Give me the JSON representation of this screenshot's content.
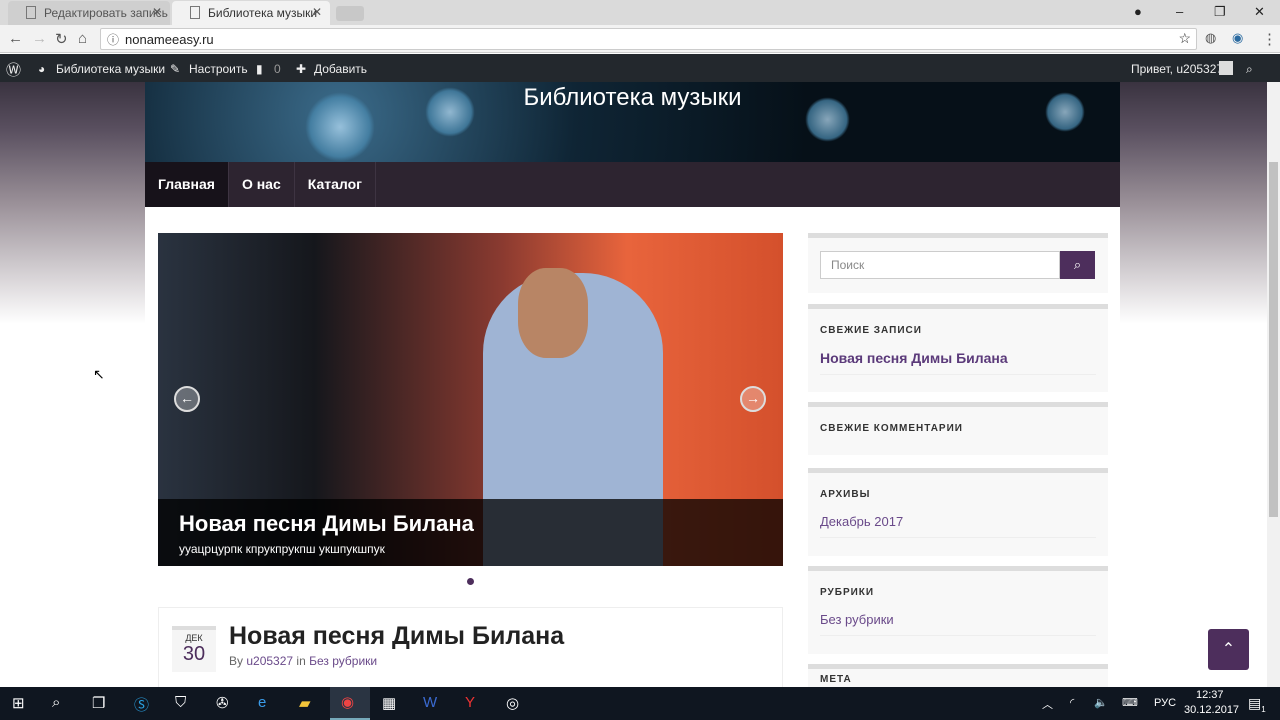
{
  "browser": {
    "tabs": [
      {
        "title": "Редактировать запись «"
      },
      {
        "title": "Библиотека музыки"
      }
    ],
    "url": "nonameeasy.ru"
  },
  "adminbar": {
    "site": "Библиотека музыки",
    "customize": "Настроить",
    "comments": "0",
    "new": "Добавить",
    "greeting": "Привет, u205327"
  },
  "site": {
    "title": "Библиотека музыки",
    "menu": [
      "Главная",
      "О нас",
      "Каталог"
    ]
  },
  "slider": {
    "title": "Новая песня Димы Билана",
    "excerpt": "ууацрцурпк кпрукпрукпш укшпукшпук"
  },
  "post": {
    "month": "ДЕК",
    "day": "30",
    "title": "Новая песня Димы Билана",
    "by": "By",
    "author": "u205327",
    "in": "in",
    "category": "Без рубрики"
  },
  "sidebar": {
    "search_placeholder": "Поиск",
    "recent_posts": {
      "title": "СВЕЖИЕ ЗАПИСИ",
      "items": [
        "Новая песня Димы Билана"
      ]
    },
    "recent_comments": {
      "title": "СВЕЖИЕ КОММЕНТАРИИ"
    },
    "archives": {
      "title": "АРХИВЫ",
      "items": [
        "Декабрь 2017"
      ]
    },
    "categories": {
      "title": "РУБРИКИ",
      "items": [
        "Без рубрики"
      ]
    },
    "meta": {
      "title": "МЕТА"
    }
  },
  "taskbar": {
    "lang": "РУС",
    "time": "12:37",
    "date": "30.12.2017",
    "notifications": "1"
  },
  "colors": {
    "accent": "#4d2e5c"
  }
}
